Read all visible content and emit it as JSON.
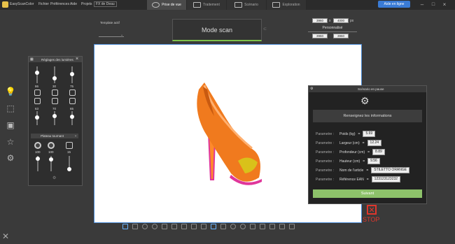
{
  "app": {
    "title": "EasyScanColor"
  },
  "menu": [
    "Fichier",
    "Préférences",
    "Aide",
    "Projets"
  ],
  "project_tab": "FX de Deau",
  "mode_tabs": [
    {
      "label": "Prise de vue",
      "active": true
    },
    {
      "label": "Traitement",
      "active": false
    },
    {
      "label": "Scénario",
      "active": false
    },
    {
      "label": "Exploration",
      "active": false
    }
  ],
  "online_button": "Aide en ligne",
  "toolbar": {
    "template_label": "Template actif",
    "mode_button": "Mode scan",
    "dim1": "3960",
    "dim_sep": "x",
    "dim2": "4000",
    "dim_unit": "px",
    "preset": "Personnalisé",
    "dim3": "3960",
    "dim4": "3960"
  },
  "light_panel": {
    "title": "Réglages des lumières",
    "top_values": [
      "86",
      "30",
      "75"
    ],
    "mid_values": [
      "63",
      "70",
      "65"
    ],
    "plateau_label": "Plateau tournant",
    "bottom_values": [
      "100",
      "100",
      "15"
    ]
  },
  "info_panel": {
    "title": "Scénario en pause",
    "banner": "Renseignez les informations",
    "rows": [
      {
        "prefix": "Parametre :",
        "name": "Poids (kg)",
        "eq": "=",
        "value": "5.69"
      },
      {
        "prefix": "Parametre :",
        "name": "Largeur (cm)",
        "eq": "=",
        "value": "12.24"
      },
      {
        "prefix": "Parametre :",
        "name": "Profondeur (cm)",
        "eq": "=",
        "value": "8.89"
      },
      {
        "prefix": "Parametre :",
        "name": "Hauteur (cm)",
        "eq": "=",
        "value": "9.56"
      },
      {
        "prefix": "Parametre :",
        "name": "Nom de l'article",
        "eq": "=",
        "value": "STILETTO ORANGE"
      },
      {
        "prefix": "Parametre :",
        "name": "Référence EAN",
        "eq": "=",
        "value": "123123123232"
      }
    ],
    "next_button": "Suivant"
  },
  "stop_label": "STOP",
  "colors": {
    "accent": "#3a7bd5",
    "green": "#8dc26a",
    "stop": "#e0362c",
    "shoe_orange": "#f07a1e",
    "shoe_pink": "#e0369a"
  }
}
